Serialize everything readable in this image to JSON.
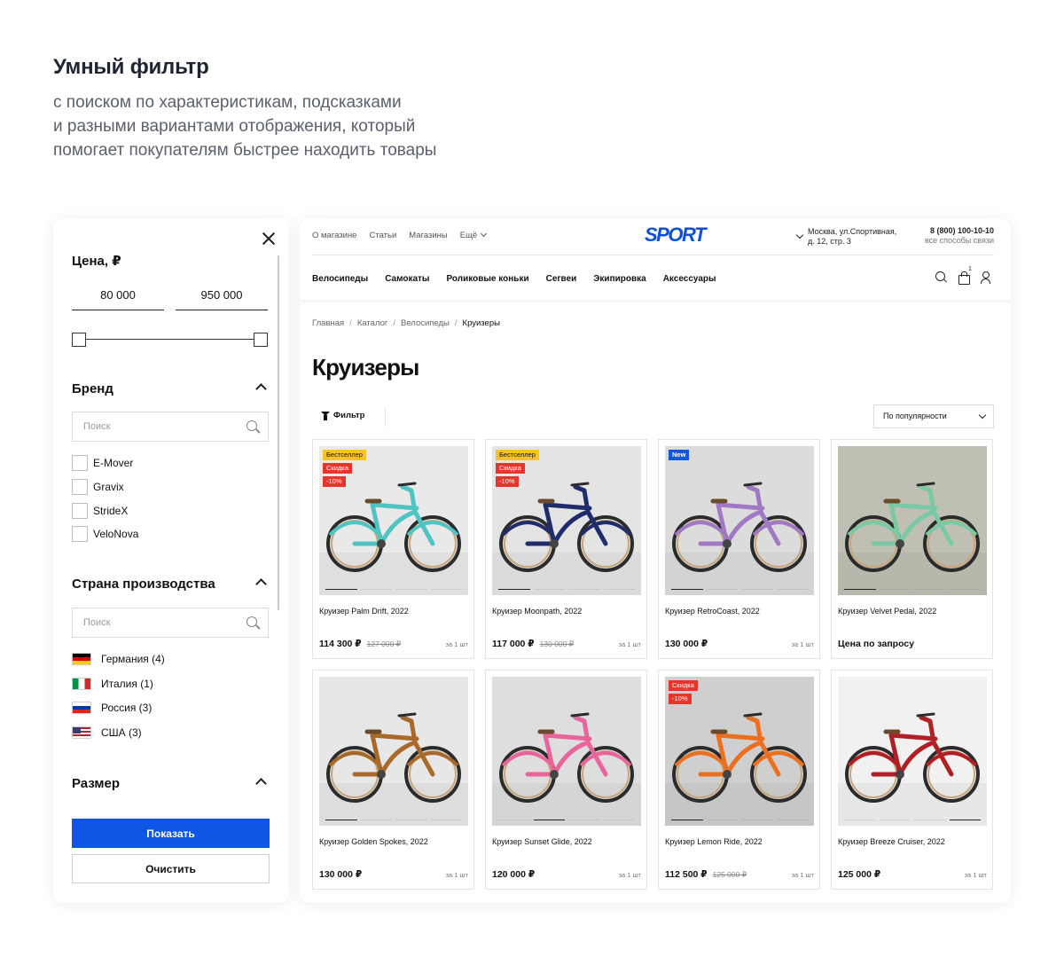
{
  "headline": {
    "title": "Умный фильтр",
    "lines": [
      "с поиском по характеристикам, подсказками",
      "и разными вариантами отображения, который",
      "помогает покупателям быстрее находить товары"
    ]
  },
  "filter": {
    "price_title": "Цена, ₽",
    "price_min": "80 000",
    "price_max": "950 000",
    "brand_title": "Бренд",
    "brand_search_placeholder": "Поиск",
    "brands": [
      "E-Mover",
      "Gravix",
      "StrideX",
      "VeloNova"
    ],
    "country_title": "Страна производства",
    "country_search_placeholder": "Поиск",
    "countries": [
      "Германия (4)",
      "Италия (1)",
      "Россия (3)",
      "США (3)"
    ],
    "size_title": "Размер",
    "show_button": "Показать",
    "clear_button": "Очистить"
  },
  "store": {
    "top_links": [
      "О магазине",
      "Статьи",
      "Магазины",
      "Ещё"
    ],
    "logo": "SPORT",
    "address_line1": "Москва, ул.Спортивная,",
    "address_line2": "д. 12, стр. 3",
    "phone": "8 (800) 100-10-10",
    "phone_sub": "все способы связи",
    "categories": [
      "Велосипеды",
      "Самокаты",
      "Роликовые коньки",
      "Сегвеи",
      "Экипировка",
      "Аксессуары"
    ],
    "cart_count": "1",
    "breadcrumbs": [
      "Главная",
      "Каталог",
      "Велосипеды",
      "Круизеры"
    ],
    "crumb_sep": "/",
    "page_title": "Круизеры",
    "filter_label": "Фильтр",
    "sort_label": "По популярности"
  },
  "products": [
    {
      "name": "Круизер Palm Drift, 2022",
      "price": "114 300 ₽",
      "old": "127 000 ₽",
      "unit": "за 1 шт",
      "badges": [
        "Бестселлер",
        "Скидка",
        "-10%"
      ],
      "color": "#4fc4c2"
    },
    {
      "name": "Круизер Moonpath, 2022",
      "price": "117 000 ₽",
      "old": "130 000 ₽",
      "unit": "за 1 шт",
      "badges": [
        "Бестселлер",
        "Скидка",
        "-10%"
      ],
      "color": "#1f2d6b"
    },
    {
      "name": "Круизер RetroCoast, 2022",
      "price": "130 000 ₽",
      "old": "",
      "unit": "за 1 шт",
      "badges": [
        "New"
      ],
      "color": "#a178c4"
    },
    {
      "name": "Круизер Velvet Pedal, 2022",
      "price": "Цена по запросу",
      "old": "",
      "unit": "",
      "badges": [],
      "color": "#79c9a4"
    },
    {
      "name": "Круизер Golden Spokes, 2022",
      "price": "130 000 ₽",
      "old": "",
      "unit": "за 1 шт",
      "badges": [],
      "color": "#a86a2c"
    },
    {
      "name": "Круизер Sunset Glide, 2022",
      "price": "120 000 ₽",
      "old": "",
      "unit": "за 1 шт",
      "badges": [],
      "color": "#e8649b"
    },
    {
      "name": "Круизер Lemon Ride, 2022",
      "price": "112 500 ₽",
      "old": "125 000 ₽",
      "unit": "за 1 шт",
      "badges": [
        "Скидка",
        "-10%"
      ],
      "color": "#ea6f1e"
    },
    {
      "name": "Круизер Breeze Cruiser, 2022",
      "price": "125 000 ₽",
      "old": "",
      "unit": "за 1 шт",
      "badges": [],
      "color": "#b01f24"
    }
  ]
}
